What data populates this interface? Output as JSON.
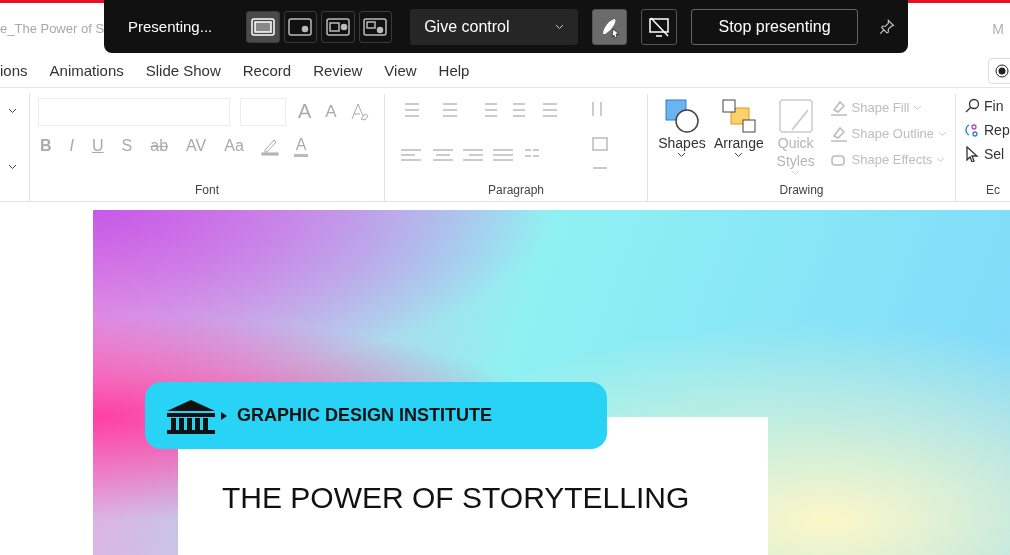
{
  "window": {
    "title": "e_The Power of S",
    "account": "M"
  },
  "presenting_bar": {
    "status": "Presenting...",
    "layouts": [
      {
        "selected": true
      },
      {
        "selected": false
      },
      {
        "selected": false
      },
      {
        "selected": false
      }
    ],
    "give_control": "Give control",
    "annotate": {
      "on": true
    },
    "stop": "Stop presenting"
  },
  "tabs": [
    {
      "label": "ions"
    },
    {
      "label": "Animations"
    },
    {
      "label": "Slide Show"
    },
    {
      "label": "Record"
    },
    {
      "label": "Review"
    },
    {
      "label": "View"
    },
    {
      "label": "Help"
    }
  ],
  "ribbon": {
    "font": {
      "label": "Font",
      "size_buttons": [
        "A",
        "A"
      ],
      "format_buttons": [
        "B",
        "I",
        "U",
        "S",
        "ab",
        "AV",
        "Aa"
      ],
      "color_button": "A",
      "disabled": true
    },
    "paragraph": {
      "label": "Paragraph",
      "disabled": true
    },
    "drawing": {
      "label": "Drawing",
      "big_buttons": [
        {
          "kind": "shapes",
          "label": "Shapes",
          "disabled": false
        },
        {
          "kind": "arrange",
          "label": "Arrange",
          "disabled": false
        },
        {
          "kind": "styles",
          "label": "Quick Styles",
          "disabled": true
        }
      ],
      "small_buttons": [
        {
          "kind": "fill",
          "label": "Shape Fill",
          "disabled": true
        },
        {
          "kind": "outline",
          "label": "Shape Outline",
          "disabled": true
        },
        {
          "kind": "effects",
          "label": "Shape Effects",
          "disabled": true
        }
      ]
    },
    "editing": {
      "label": "Ec",
      "buttons": [
        {
          "kind": "find",
          "label": "Fin"
        },
        {
          "kind": "replace",
          "label": "Rep"
        },
        {
          "kind": "select",
          "label": "Sel"
        }
      ]
    }
  },
  "slide": {
    "brand": "GRAPHIC DESIGN INSTITUTE",
    "title": "THE POWER OF STORYTELLING"
  }
}
